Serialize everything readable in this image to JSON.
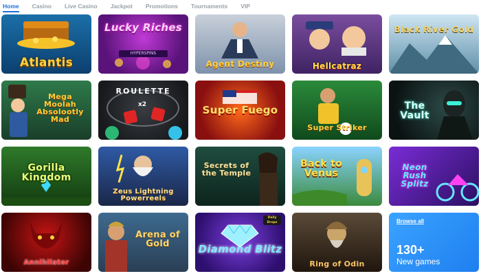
{
  "nav": {
    "items": [
      {
        "label": "Home",
        "active": true
      },
      {
        "label": "Casino",
        "active": false
      },
      {
        "label": "Live Casino",
        "active": false
      },
      {
        "label": "Jackpot",
        "active": false
      },
      {
        "label": "Promotions",
        "active": false
      },
      {
        "label": "Tournaments",
        "active": false
      },
      {
        "label": "VIP",
        "active": false
      }
    ]
  },
  "games": [
    {
      "title": "Atlantis"
    },
    {
      "title": "Lucky Riches",
      "badge": "HYPERSPINS"
    },
    {
      "title": "Agent Destiny"
    },
    {
      "title": "Hellcatraz"
    },
    {
      "title": "Black River Gold"
    },
    {
      "title": "Mega Moolah Absolootly Mad"
    },
    {
      "title": "ROULETTE",
      "badge": "x2"
    },
    {
      "title": "Super Fuego"
    },
    {
      "title": "Super Striker"
    },
    {
      "title": "The Vault"
    },
    {
      "title": "Gorilla Kingdom"
    },
    {
      "title": "Zeus Lightning Powerreels"
    },
    {
      "title": "Secrets of the Temple"
    },
    {
      "title": "Back to Venus"
    },
    {
      "title": "Neon Rush Splitz"
    },
    {
      "title": "Annihilator"
    },
    {
      "title": "Arena of Gold"
    },
    {
      "title": "Diamond Blitz",
      "badge": "Daily Drops"
    },
    {
      "title": "Ring of Odin"
    }
  ],
  "browse": {
    "link_label": "Browse all",
    "count": "130+",
    "count_label": "New games"
  },
  "colors": {
    "accent": "#1f6fd6",
    "nav_inactive": "#9a9fa6",
    "browse_tile": "#2a8cf6"
  }
}
